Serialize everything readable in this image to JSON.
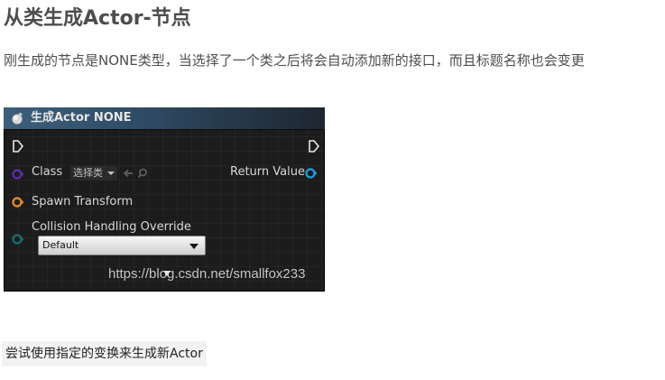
{
  "page": {
    "title": "从类生成Actor-节点",
    "description": "刚生成的节点是NONE类型，当选择了一个类之后将会自动添加新的接口，而且标题名称也会变更"
  },
  "node": {
    "title": "生成Actor NONE",
    "inputs": {
      "class_label": "Class",
      "class_select_value": "选择类",
      "spawn_transform_label": "Spawn Transform",
      "collision_label": "Collision Handling Override",
      "collision_value": "Default"
    },
    "outputs": {
      "return_value_label": "Return Value"
    },
    "colors": {
      "class_pin": "#5b2aa8",
      "transform_pin": "#e7852a",
      "collision_pin": "#1a6b6b",
      "return_pin": "#1e9ad6",
      "header": "#3d5f7c"
    },
    "watermark": "https://blog.csdn.net/smallfox233"
  },
  "caption": {
    "text": "尝试使用指定的变换来生成新Actor"
  }
}
